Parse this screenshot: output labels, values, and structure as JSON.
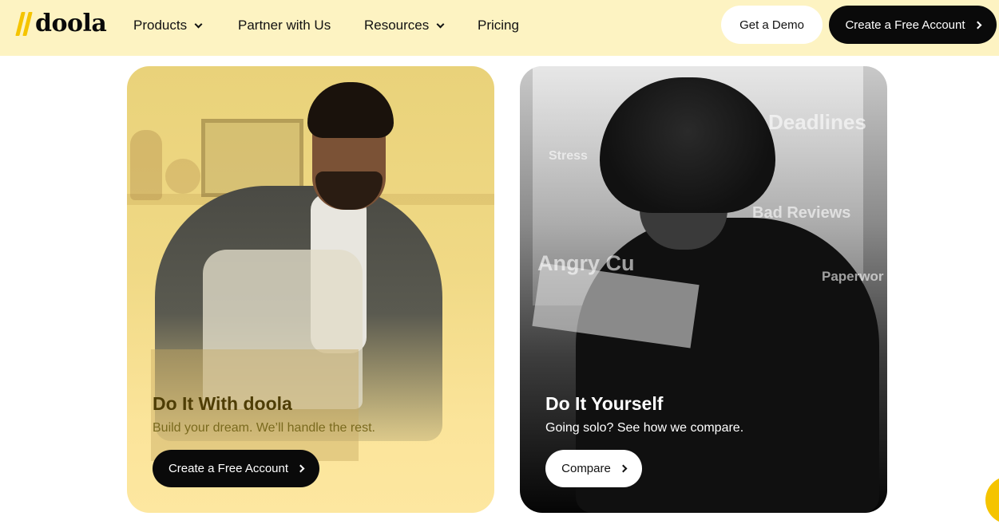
{
  "brand": {
    "logo_text": "doola",
    "accent": "#f5c400"
  },
  "nav": {
    "items": [
      {
        "label": "Products",
        "has_dropdown": true
      },
      {
        "label": "Partner with Us",
        "has_dropdown": false
      },
      {
        "label": "Resources",
        "has_dropdown": true
      },
      {
        "label": "Pricing",
        "has_dropdown": false
      }
    ],
    "demo_label": "Get a Demo",
    "create_label": "Create a Free Account"
  },
  "cards": {
    "left": {
      "title": "Do It With doola",
      "subtitle": "Build your dream. We’ll handle the rest.",
      "button_label": "Create a Free Account"
    },
    "right": {
      "title": "Do It Yourself",
      "subtitle": "Going solo? See how we compare.",
      "button_label": "Compare",
      "floating_words": [
        "Deadlines",
        "Stress",
        "Bad Reviews",
        "Angry Cu",
        "Paperwor"
      ]
    }
  }
}
